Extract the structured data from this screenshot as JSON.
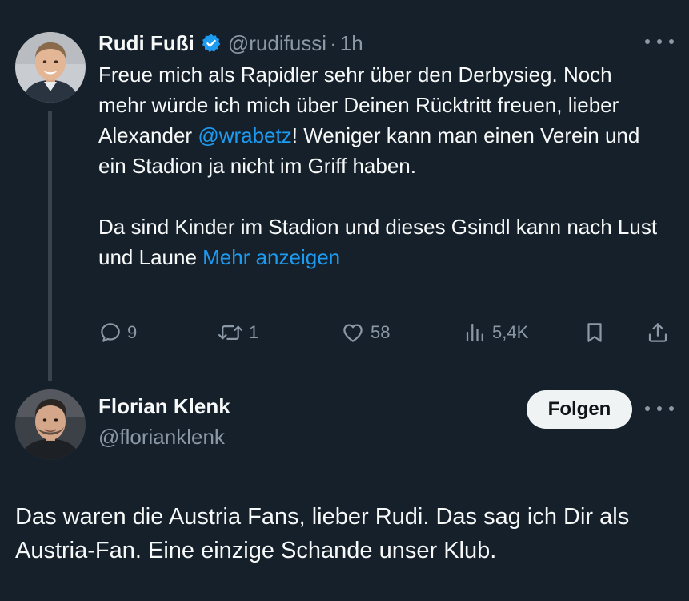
{
  "reply_tweet": {
    "author": {
      "display_name": "Rudi Fußi",
      "handle": "@rudifussi",
      "verified": true
    },
    "separator": "·",
    "timestamp": "1h",
    "text": {
      "p1_before_mention": "Freue mich als Rapidler sehr über den Derbysieg. Noch mehr würde ich mich über Deinen Rücktritt freuen, lieber Alexander ",
      "mention": "@wrabetz",
      "p1_after_mention": "! Weniger kann man einen Verein und ein Stadion ja nicht im Griff haben.",
      "p2": "Da sind Kinder im Stadion und dieses Gsindl kann nach Lust und Laune ",
      "show_more": "Mehr anzeigen"
    },
    "metrics": {
      "replies": "9",
      "reposts": "1",
      "likes": "58",
      "views": "5,4K"
    },
    "icons": [
      "reply-icon",
      "repost-icon",
      "like-icon",
      "views-icon",
      "bookmark-icon",
      "share-icon",
      "verified-badge-icon",
      "more-icon"
    ],
    "colors": {
      "verified": "#1d9bf0",
      "link": "#1d9bf0"
    }
  },
  "main_tweet": {
    "author": {
      "display_name": "Florian Klenk",
      "handle": "@florianklenk"
    },
    "follow_label": "Folgen",
    "text": "Das waren die Austria Fans, lieber Rudi. Das sag ich Dir als Austria-Fan. Eine einzige Schande unser Klub."
  },
  "theme": {
    "background": "#15202b",
    "text_primary": "#f7f9f9",
    "text_secondary": "#8b98a5"
  }
}
